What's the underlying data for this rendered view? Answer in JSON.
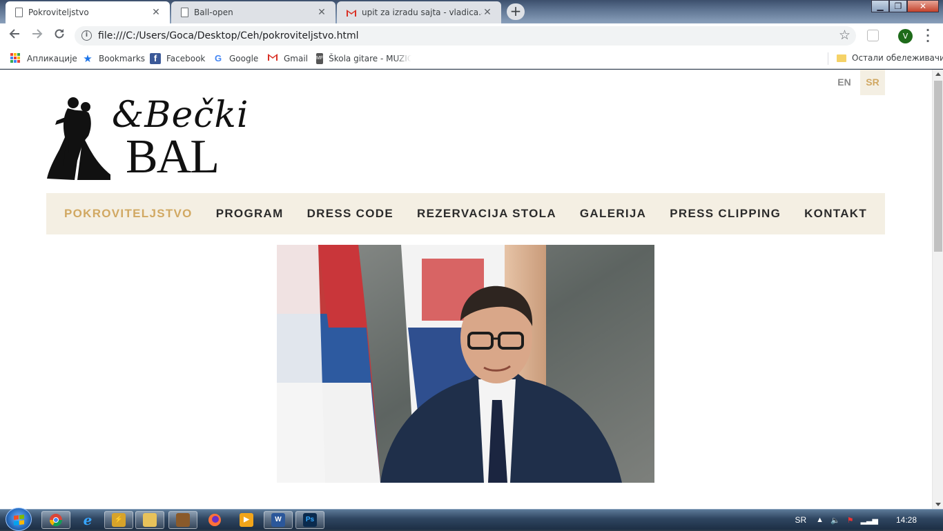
{
  "browser": {
    "tabs": [
      {
        "title": "Pokroviteljstvo",
        "active": true,
        "icon": "document-icon"
      },
      {
        "title": "Ball-open",
        "active": false,
        "icon": "document-icon"
      },
      {
        "title": "upit za izradu sajta - vladica.aleks",
        "active": false,
        "icon": "gmail-icon"
      }
    ],
    "new_tab_symbol": "+",
    "window_controls": {
      "minimize": "▁",
      "maximize": "❐",
      "close": "✕"
    },
    "url": "file:///C:/Users/Goca/Desktop/Ceh/pokroviteljstvo.html",
    "profile_initial": "V",
    "bookmarks": [
      {
        "label": "Апликације",
        "icon": "apps-grid-icon"
      },
      {
        "label": "Bookmarks",
        "icon": "star-icon"
      },
      {
        "label": "Facebook",
        "icon": "facebook-icon"
      },
      {
        "label": "Google",
        "icon": "google-icon"
      },
      {
        "label": "Gmail",
        "icon": "gmail-icon"
      },
      {
        "label": "Škola gitare - MUZIC",
        "icon": "mf-icon"
      }
    ],
    "other_bookmarks": "Остали обележивачи"
  },
  "page": {
    "languages": {
      "en": "EN",
      "sr": "SR",
      "active": "SR"
    },
    "logo": {
      "script_text": "&Bečki",
      "main_text": "BAL"
    },
    "nav": [
      {
        "label": "POKROVITELJSTVO",
        "active": true
      },
      {
        "label": "PROGRAM",
        "active": false
      },
      {
        "label": "DRESS CODE",
        "active": false
      },
      {
        "label": "REZERVACIJA STOLA",
        "active": false
      },
      {
        "label": "GALERIJA",
        "active": false
      },
      {
        "label": "PRESS CLIPPING",
        "active": false
      },
      {
        "label": "KONTAKT",
        "active": false
      }
    ],
    "colors": {
      "accent": "#d1a862",
      "nav_bg": "#f4efe3",
      "nav_text": "#2b2b2b"
    }
  },
  "taskbar": {
    "apps": [
      "chrome",
      "internet-explorer",
      "winamp",
      "explorer",
      "archiver",
      "firefox",
      "media-player",
      "word",
      "photoshop"
    ],
    "photoshop_label": "Ps",
    "word_label": "W",
    "language": "SR",
    "time": "14:28"
  }
}
